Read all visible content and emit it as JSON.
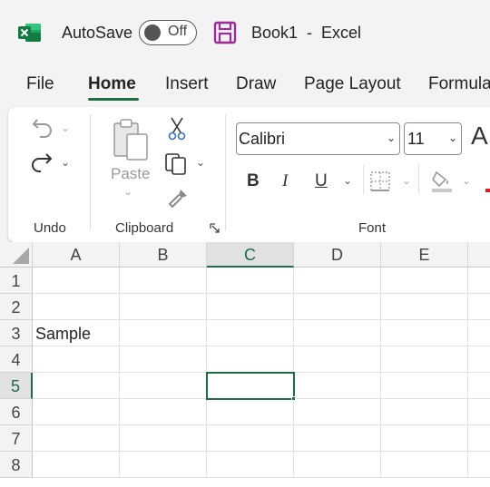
{
  "titlebar": {
    "autosave_label": "AutoSave",
    "autosave_state": "Off",
    "document_title": "Book1  -  Excel",
    "colors": {
      "excel_green": "#107c41",
      "save_purple": "#9b2d9b"
    }
  },
  "tabs": [
    {
      "label": "File",
      "active": false
    },
    {
      "label": "Home",
      "active": true
    },
    {
      "label": "Insert",
      "active": false
    },
    {
      "label": "Draw",
      "active": false
    },
    {
      "label": "Page Layout",
      "active": false
    },
    {
      "label": "Formulas",
      "active": false
    }
  ],
  "ribbon": {
    "undo_group": {
      "label": "Undo",
      "icons": [
        "undo-icon",
        "redo-icon"
      ]
    },
    "clipboard_group": {
      "label": "Clipboard",
      "paste_label": "Paste",
      "icons": [
        "paste-icon",
        "cut-icon",
        "copy-icon",
        "format-painter-icon",
        "dialog-launcher-icon"
      ]
    },
    "font_group": {
      "label": "Font",
      "font_name": "Calibri",
      "font_size": "11",
      "bold": "B",
      "italic": "I",
      "underline": "U",
      "grow_font": "A",
      "icons": [
        "borders-icon",
        "fill-color-icon",
        "font-color-icon"
      ]
    }
  },
  "grid": {
    "columns": [
      "A",
      "B",
      "C",
      "D",
      "E"
    ],
    "rows": [
      "1",
      "2",
      "3",
      "4",
      "5",
      "6",
      "7",
      "8"
    ],
    "selected_column": "C",
    "selected_row": "5",
    "cells": {
      "A3": "Sample"
    },
    "accent": "#1e6c41"
  }
}
